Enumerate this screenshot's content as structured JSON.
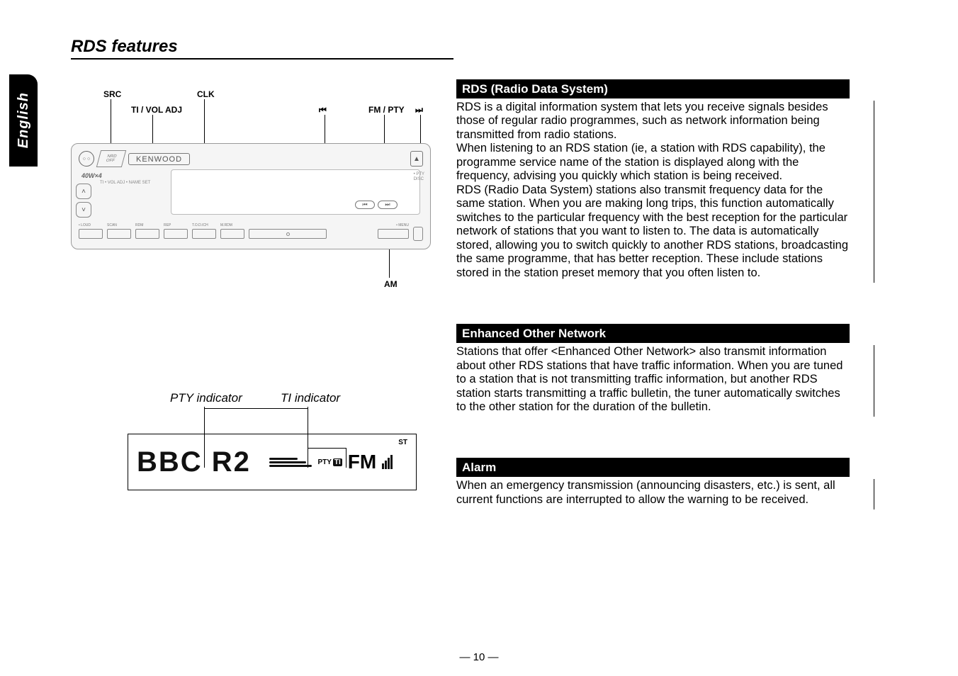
{
  "language_tab": "English",
  "page_title": "RDS features",
  "page_number": "— 10 —",
  "diagram_labels": {
    "src": "SRC",
    "clk": "CLK",
    "ti_vol_adj": "TI / VOL ADJ",
    "prev_track": "⏮",
    "fm_pty": "FM / PTY",
    "next_track": "⏭",
    "am": "AM"
  },
  "device": {
    "brand": "KENWOOD",
    "power": "40W×4",
    "tiny_under_power": "TI • VOL ADJ   • NAME SET",
    "eject": "▲",
    "up": "˄",
    "down": "˅",
    "right_small": "• PTY\nDISC",
    "menu": "• MENU",
    "micro_prev": "⏮",
    "micro_next": "⏭",
    "bottom": {
      "loud": "• LOUD",
      "scan": "SCAN",
      "rdm": "RDM",
      "rep": "REP",
      "to_dich": "T.O.D.ICH",
      "mrdm": "M.RDM"
    }
  },
  "lcd": {
    "pty_indicator_label": "PTY indicator",
    "ti_indicator_label": "TI indicator",
    "text_main": "BBC  R2",
    "pty": "PTY",
    "ti": "TI",
    "fm": "FM",
    "st": "ST"
  },
  "sections": {
    "rds": {
      "heading": "RDS (Radio Data System)",
      "body": "RDS is a digital information system that lets you receive signals besides those of regular radio programmes, such as network information being transmitted from radio stations.\nWhen listening to an RDS station (ie, a station with RDS capability), the programme service name of the station is displayed along with the frequency, advising you quickly which station is being received.\nRDS (Radio Data System) stations also transmit frequency data for the same  station.  When you are making long trips, this function automatically switches to the particular frequency with the best reception for the particular network of stations that you want to listen to.  The data is automatically stored, allowing you to switch quickly to another RDS stations, broadcasting the same programme, that has better reception. These include stations stored in the station preset memory that you often listen to."
    },
    "eon": {
      "heading": "Enhanced Other Network",
      "body": "Stations that offer <Enhanced Other Network> also transmit information about other RDS stations that have traffic information. When you are tuned to a station that is not transmitting traffic information, but another RDS station starts transmitting a traffic bulletin, the tuner automatically switches to the other station for the duration of the bulletin."
    },
    "alarm": {
      "heading": "Alarm",
      "body": "When an emergency transmission (announcing disasters, etc.) is sent, all current functions are interrupted to allow the warning to be received."
    }
  }
}
